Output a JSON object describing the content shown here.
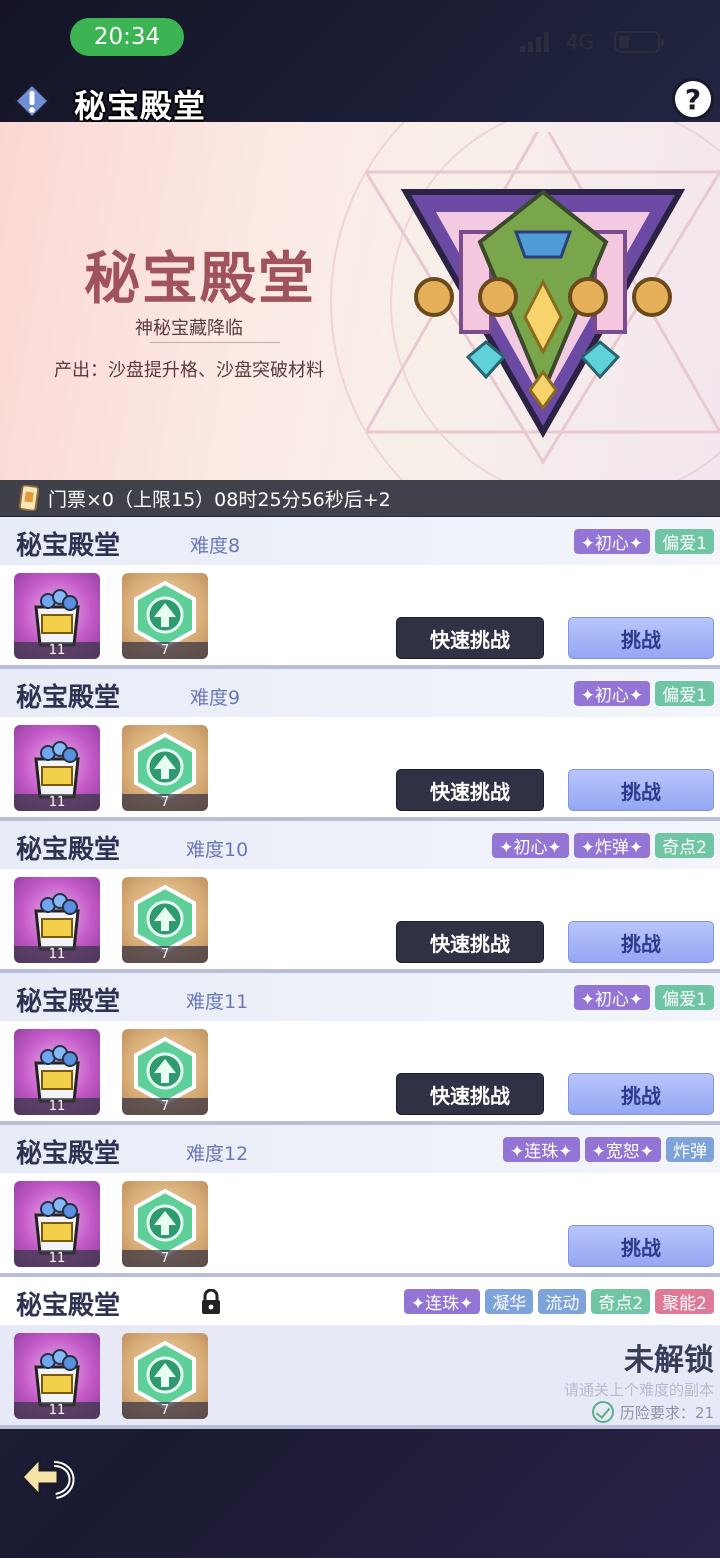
{
  "status": {
    "time": "20:34",
    "network": "4G"
  },
  "header": {
    "title": "秘宝殿堂",
    "alert_icon": "alert-icon",
    "help_label": "?"
  },
  "banner": {
    "title": "秘宝殿堂",
    "subtitle": "神秘宝藏降临",
    "description": "产出：沙盘提升格、沙盘突破材料"
  },
  "ticket": {
    "text": "门票×0（上限15）08时25分56秒后+2"
  },
  "rows": [
    {
      "name": "秘宝殿堂",
      "difficulty": "难度8",
      "tags": [
        "✦初心✦",
        "偏爱1"
      ],
      "items": [
        "11",
        "7"
      ],
      "quick": "快速挑战",
      "challenge": "挑战"
    },
    {
      "name": "秘宝殿堂",
      "difficulty": "难度9",
      "tags": [
        "✦初心✦",
        "偏爱1"
      ],
      "items": [
        "11",
        "7"
      ],
      "quick": "快速挑战",
      "challenge": "挑战"
    },
    {
      "name": "秘宝殿堂",
      "difficulty": "难度10",
      "tags": [
        "✦初心✦",
        "✦炸弹✦",
        "奇点2"
      ],
      "items": [
        "11",
        "7"
      ],
      "quick": "快速挑战",
      "challenge": "挑战"
    },
    {
      "name": "秘宝殿堂",
      "difficulty": "难度11",
      "tags": [
        "✦初心✦",
        "偏爱1"
      ],
      "items": [
        "11",
        "7"
      ],
      "quick": "快速挑战",
      "challenge": "挑战"
    },
    {
      "name": "秘宝殿堂",
      "difficulty": "难度12",
      "tags": [
        "✦连珠✦",
        "✦宽恕✦",
        "炸弹"
      ],
      "items": [
        "11",
        "7"
      ],
      "challenge": "挑战"
    },
    {
      "name": "秘宝殿堂",
      "tags": [
        "✦连珠✦",
        "凝华",
        "流动",
        "奇点2",
        "聚能2"
      ],
      "items": [
        "11",
        "7"
      ],
      "locked_title": "未解锁",
      "locked_hint": "请通关上个难度的副本",
      "locked_req": "历险要求：21"
    }
  ],
  "colors": {
    "accent": "#95a7f3",
    "quick_btn": "#2f3144",
    "time_pill": "#3cb454"
  }
}
